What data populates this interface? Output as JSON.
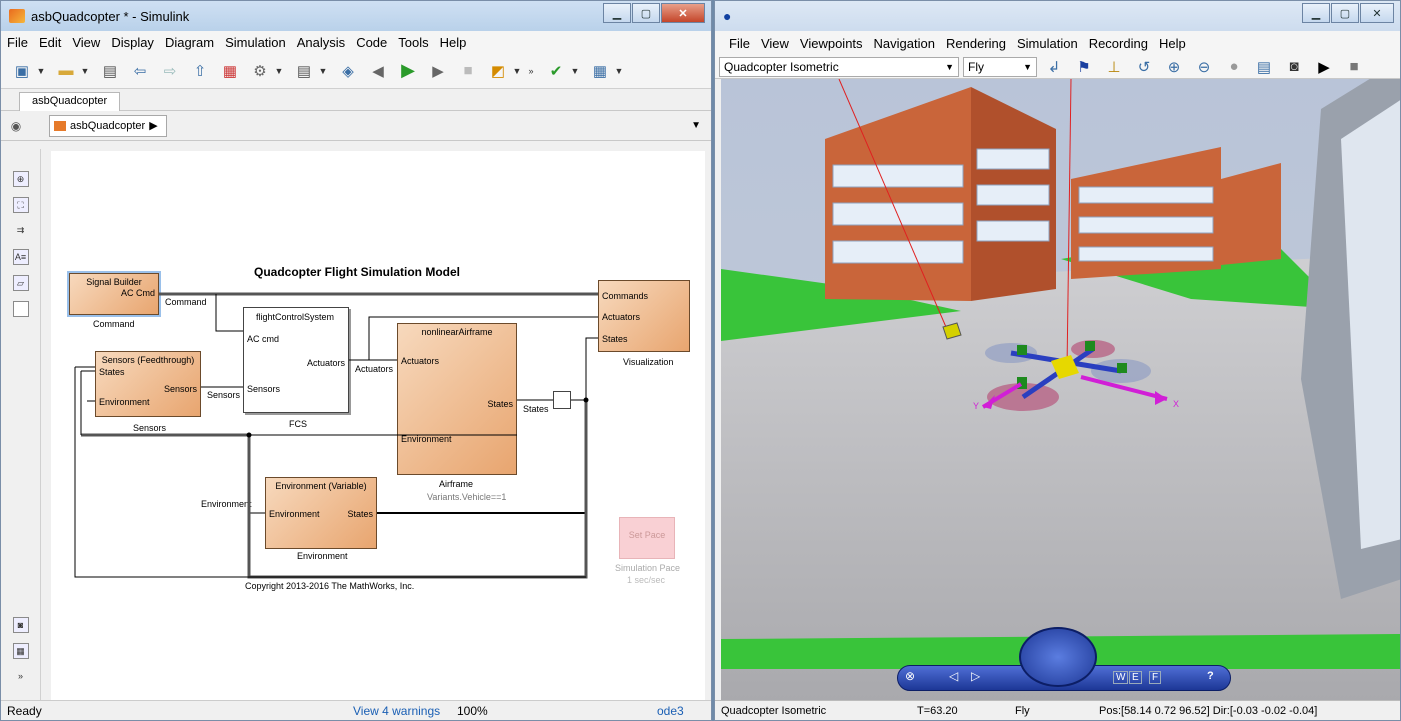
{
  "simulink": {
    "title": "asbQuadcopter * - Simulink",
    "menu": [
      "File",
      "Edit",
      "View",
      "Display",
      "Diagram",
      "Simulation",
      "Analysis",
      "Code",
      "Tools",
      "Help"
    ],
    "tab": "asbQuadcopter",
    "address": "asbQuadcopter",
    "model_title": "Quadcopter Flight Simulation Model",
    "copyright": "Copyright 2013-2016 The MathWorks, Inc.",
    "blocks": {
      "signal_builder": {
        "title": "Signal Builder",
        "port": "AC Cmd",
        "label": "Command"
      },
      "sensors": {
        "title": "Sensors (Feedthrough)",
        "in1": "States",
        "in2": "Environment",
        "out": "Sensors",
        "label": "Sensors"
      },
      "fcs": {
        "title": "flightControlSystem",
        "in1": "AC cmd",
        "in2": "Sensors",
        "out": "Actuators",
        "label": "FCS"
      },
      "airframe": {
        "title": "nonlinearAirframe",
        "in1": "Actuators",
        "in2": "Environment",
        "out": "States",
        "label": "Airframe",
        "sublabel": "Variants.Vehicle==1"
      },
      "environment": {
        "title": "Environment (Variable)",
        "in1": "Environment",
        "out": "States",
        "label": "Environment"
      },
      "visualization": {
        "in1": "Commands",
        "in2": "Actuators",
        "in3": "States",
        "label": "Visualization"
      },
      "pace": {
        "title": "Set Pace",
        "label": "Simulation Pace",
        "sublabel": "1 sec/sec"
      }
    },
    "signals": {
      "command": "Command",
      "sensors": "Sensors",
      "actuators": "Actuators",
      "states": "States",
      "environment": "Environment"
    },
    "status": {
      "left": "Ready",
      "mid": "View 4 warnings",
      "zoom": "100%",
      "solver": "ode3"
    }
  },
  "vr": {
    "menu": [
      "File",
      "View",
      "Viewpoints",
      "Navigation",
      "Rendering",
      "Simulation",
      "Recording",
      "Help"
    ],
    "viewpoint": "Quadcopter Isometric",
    "nav_mode": "Fly",
    "status": {
      "viewpoint": "Quadcopter Isometric",
      "time": "T=63.20",
      "mode": "Fly",
      "pos": "Pos:[58.14 0.72 96.52] Dir:[-0.03 -0.02 -0.04]"
    },
    "axis_x": "X",
    "axis_y": "Y",
    "nav_panel": {
      "w": "W",
      "e": "E",
      "f": "F",
      "help": "?"
    }
  },
  "colors": {
    "block_fill": "#e8a56f",
    "grass": "#39c43a",
    "wall": "#c9653a",
    "axis": "#d11fd6"
  }
}
